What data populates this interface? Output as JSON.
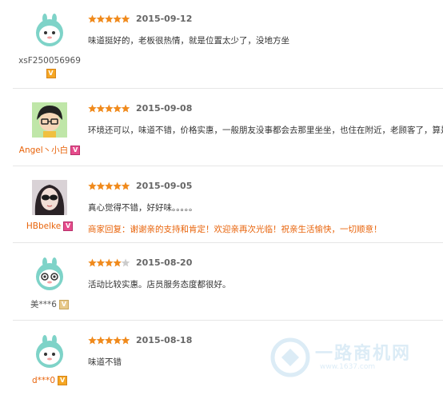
{
  "reviews": [
    {
      "user": "xsF250056969",
      "user_color": "#555555",
      "badge": "V",
      "badge_color": "orange",
      "avatar": "bunny-avatar",
      "rating": 5,
      "date": "2015-09-12",
      "text": "味道挺好的，老板很热情，就是位置太少了，没地方坐",
      "reply": ""
    },
    {
      "user": "Angel丶小白",
      "user_color": "#e8630a",
      "badge": "V",
      "badge_color": "pink",
      "avatar": "cartoon-boy-avatar",
      "rating": 5,
      "date": "2015-09-08",
      "text": "环境还可以，味道不错，价格实惠，一般朋友没事都会去那里坐坐，也住在附近，老顾客了，算是",
      "reply": ""
    },
    {
      "user": "HBbelke",
      "user_color": "#e8630a",
      "badge": "V",
      "badge_color": "pink",
      "avatar": "girl-sunglasses-avatar",
      "rating": 5,
      "date": "2015-09-05",
      "text": "真心觉得不错，好好味。。。。。",
      "reply": "商家回复：谢谢亲的支持和肯定！欢迎亲再次光临！祝亲生活愉快，一切顺意！"
    },
    {
      "user": "美***6",
      "user_color": "#555555",
      "badge": "V",
      "badge_color": "tan",
      "avatar": "bunny-avatar",
      "rating": 4,
      "date": "2015-08-20",
      "text": "活动比较实惠。店员服务态度都很好。",
      "reply": ""
    },
    {
      "user": "d***0",
      "user_color": "#e8630a",
      "badge": "V",
      "badge_color": "orange",
      "avatar": "bunny-avatar",
      "rating": 5,
      "date": "2015-08-18",
      "text": "味道不错",
      "reply": ""
    }
  ],
  "watermark": {
    "text": "一路商机网",
    "sub": "www.1637.com"
  },
  "colors": {
    "star_on": "#f08a1c",
    "star_off": "#cccccc",
    "reply": "#e8630a"
  }
}
